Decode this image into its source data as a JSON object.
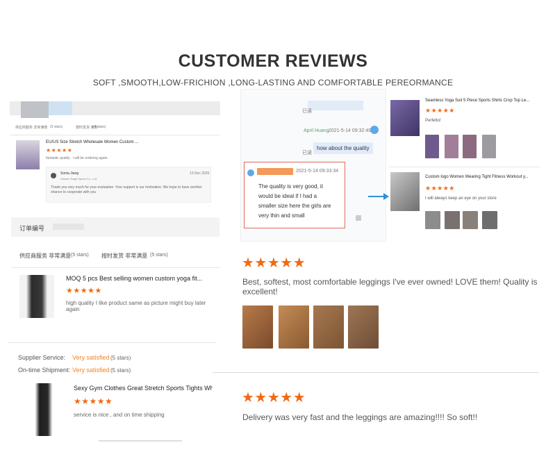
{
  "header": {
    "title": "CUSTOMER REVIEWS",
    "subtitle": "SOFT ,SMOOTH,LOW-FRICHION ,LONG-LASTING AND COMFORTABLE PEREORMANCE"
  },
  "left_top": {
    "meta": [
      "供应商服务 非常满意",
      "(5 stars)",
      "按时发货 满意",
      "(4 stars)"
    ],
    "product_title": "EU/US Size Stretch Wholesale Women Custom ...",
    "stars": "★★★★★",
    "review": "fantastic quality . i will be ordering again.",
    "reply": {
      "name": "Sonia Jiang",
      "company": "Xiamen Sage Sports Co., Ltd.",
      "date": "13 Dec 2020",
      "text": "Thank you very much for your evaluation. Your support is our motivation. We hope to have another chance to cooperate with you"
    }
  },
  "left_mid": {
    "order_label": "订单编号",
    "supplier_service": "供应商服务 非常满意",
    "supplier_stars": "(5 stars)",
    "shipment": "按时发货 非常满意",
    "shipment_stars": "(5 stars)",
    "product_title": "MOQ 5 pcs Best selling women custom yoga fit...",
    "stars": "★★★★★",
    "review": "high quality I like product same as picture might buy later again"
  },
  "left_bottom": {
    "supplier_label": "Supplier Service:",
    "supplier_value": "Very satisfied",
    "supplier_stars": "(5 stars)",
    "shipment_label": "On-time Shipment:",
    "shipment_value": "Very satisfied",
    "shipment_stars": "(5 stars)",
    "product_title": "Sexy Gym Clothes Great Stretch Sports Tights Wholes",
    "stars": "★★★★★",
    "review": "service is nice , and on time shipping"
  },
  "chat": {
    "read1": "已读",
    "sender": "April Huang",
    "timestamp1": "2021-5-14 09:32:49",
    "message": "how about the quality",
    "read2": "已读",
    "timestamp2": "2021-5-14 09:33:34",
    "reply": "The quality is very good, it would be ideal if I had a smaller size here the girls are very thin and small"
  },
  "right_products": [
    {
      "title": "Seamless Yoga Suit 5 Piece Sports Shirts Crop Top Le...",
      "stars": "★★★★★",
      "review": "Perfetto!"
    },
    {
      "title": "Custom logo Women Wearing Tight Fitness Workout y...",
      "stars": "★★★★★",
      "review": "I will always keep an eye on your store"
    }
  ],
  "review1": {
    "stars": "★★★★★",
    "text": "Best, softest, most comfortable leggings I've ever owned! LOVE them! Quality is excellent!"
  },
  "review2": {
    "stars": "★★★★★",
    "text": "Delivery was very fast and the leggings are amazing!!!! So soft!!"
  },
  "colors": {
    "star": "#f06a14",
    "accent_orange": "#f5801f",
    "arrow_blue": "#2f8fd8",
    "highlight_red": "#e06b5a"
  }
}
